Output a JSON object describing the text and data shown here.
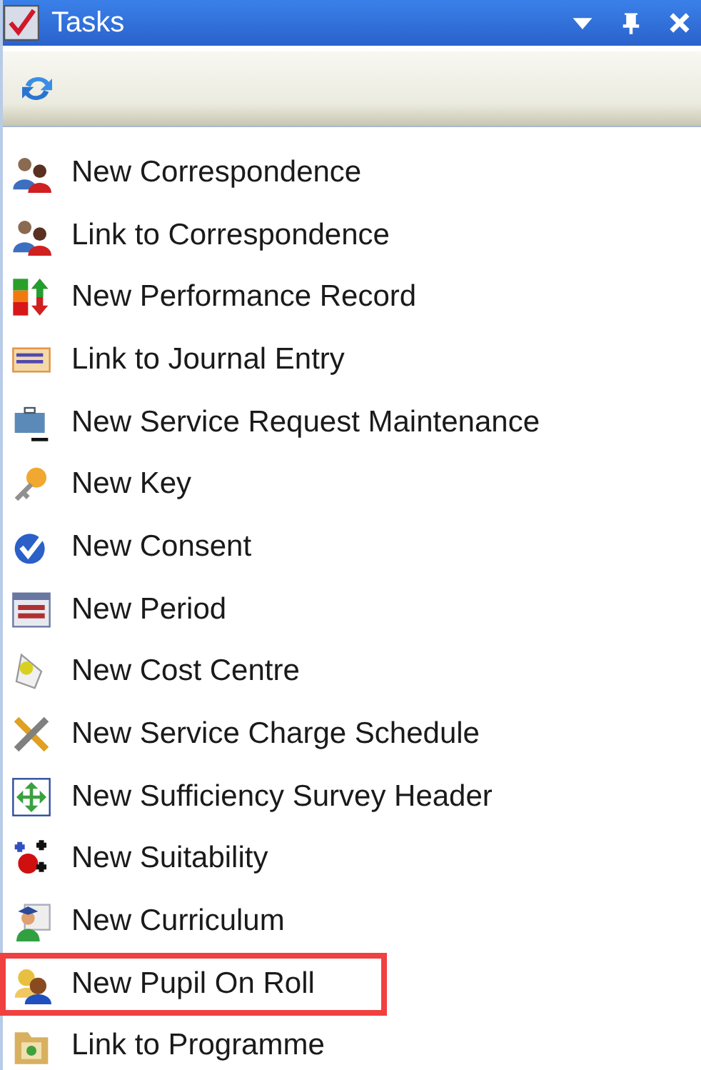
{
  "window": {
    "title": "Tasks"
  },
  "items": [
    {
      "label": "New Correspondence",
      "selected": false
    },
    {
      "label": "Link to Correspondence",
      "selected": false
    },
    {
      "label": "New Performance Record",
      "selected": false
    },
    {
      "label": "Link to Journal Entry",
      "selected": false
    },
    {
      "label": "New Service Request Maintenance",
      "selected": false
    },
    {
      "label": "New Key",
      "selected": false
    },
    {
      "label": "New Consent",
      "selected": false
    },
    {
      "label": "New Period",
      "selected": false
    },
    {
      "label": "New Cost Centre",
      "selected": false
    },
    {
      "label": "New Service Charge Schedule",
      "selected": false
    },
    {
      "label": "New Sufficiency Survey Header",
      "selected": false
    },
    {
      "label": "New Suitability",
      "selected": false
    },
    {
      "label": "New Curriculum",
      "selected": false
    },
    {
      "label": "New Pupil On Roll",
      "selected": true
    },
    {
      "label": "Link to Programme",
      "selected": false
    }
  ]
}
